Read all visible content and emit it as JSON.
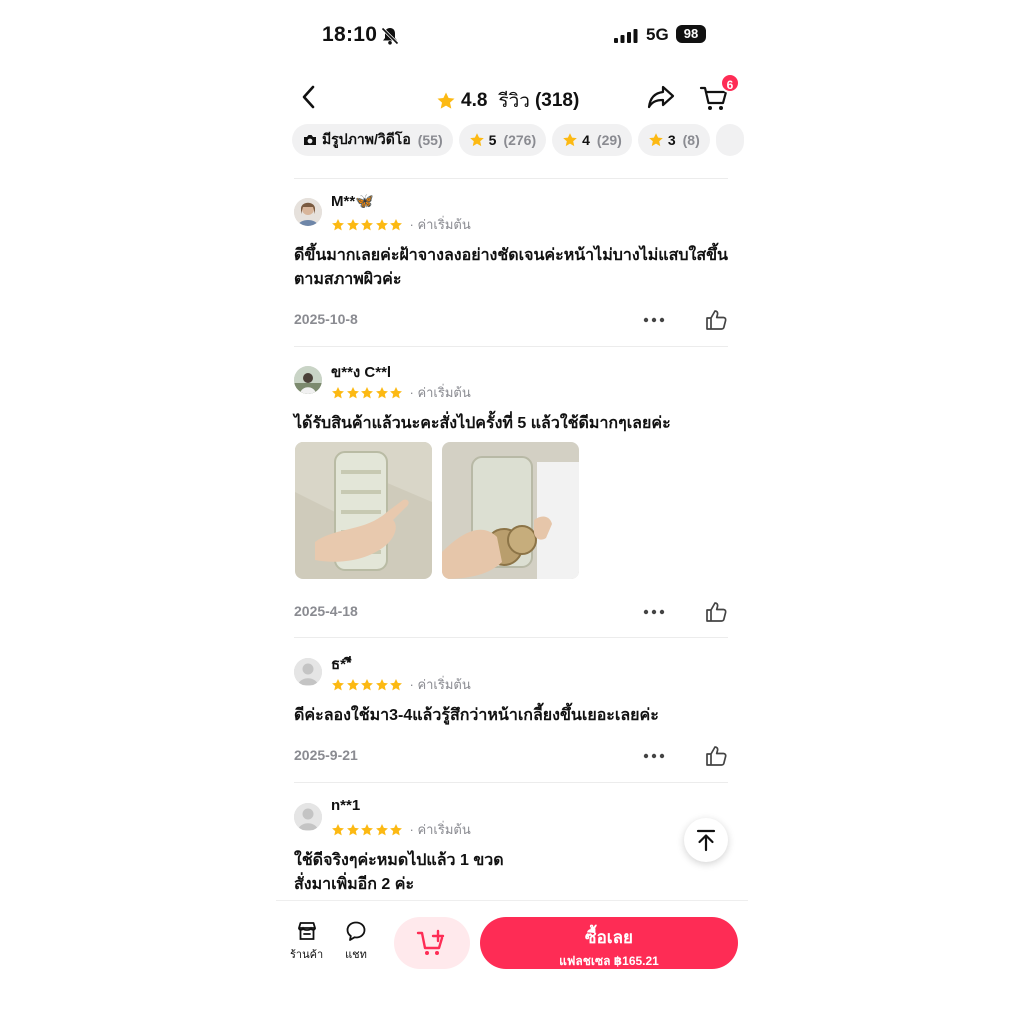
{
  "status_bar": {
    "time": "18:10",
    "network": "5G",
    "battery": "98"
  },
  "header": {
    "rating": "4.8",
    "reviews_label": "รีวิว",
    "reviews_count": "(318)",
    "cart_badge": "6"
  },
  "filters": [
    {
      "label": "มีรูปภาพ/วิดีโอ",
      "count": "(55)",
      "icon": "camera-icon"
    },
    {
      "label": "5",
      "count": "(276)",
      "icon": "star-icon"
    },
    {
      "label": "4",
      "count": "(29)",
      "icon": "star-icon"
    },
    {
      "label": "3",
      "count": "(8)",
      "icon": "star-icon"
    }
  ],
  "reviews": [
    {
      "user": "M**🦋",
      "stars": 5,
      "variant": "· ค่าเริ่มต้น",
      "text": "ดีขึ้นมากเลยค่ะฝ้าจางลงอย่างชัดเจนค่ะหน้าไม่บางไม่แสบใสขึ้นตามสภาพผิวค่ะ",
      "date": "2025-10-8"
    },
    {
      "user": "ข**ง C**l",
      "stars": 5,
      "variant": "· ค่าเริ่มต้น",
      "text": "ได้รับสินค้าแล้วนะคะสั่งไปครั้งที่ 5 แล้วใช้ดีมากๆเลยค่ะ",
      "date": "2025-4-18",
      "photos": 2
    },
    {
      "user": "ธ**ี",
      "stars": 5,
      "variant": "· ค่าเริ่มต้น",
      "text": "ดีค่ะลองใช้มา3-4แล้วรู้สึกว่าหน้าเกลี้ยงขึ้นเยอะเลยค่ะ",
      "date": "2025-9-21"
    },
    {
      "user": "n**1",
      "stars": 5,
      "variant": "· ค่าเริ่มต้น",
      "text": "ใช้ดีจริงๆค่ะหมดไปแล้ว 1 ขวด\nสั่งมาเพิ่มอีก 2 ค่ะ"
    }
  ],
  "bottom_bar": {
    "shop_label": "ร้านค้า",
    "chat_label": "แชท",
    "buy_label": "ซื้อเลย",
    "flash_label": "แฟลชเซล ฿165.21"
  },
  "colors": {
    "accent": "#fe2c55",
    "star": "#fcb913",
    "muted": "#8a8b91"
  }
}
